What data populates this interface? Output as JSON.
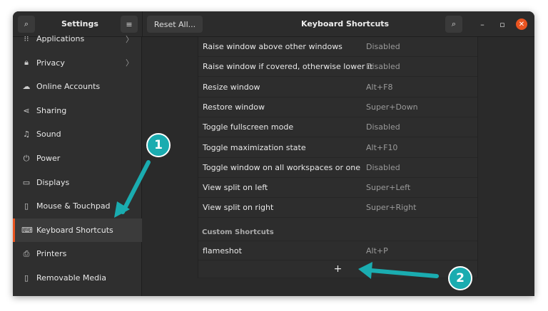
{
  "header": {
    "sidebar_title": "Settings",
    "reset_label": "Reset All...",
    "title": "Keyboard Shortcuts"
  },
  "sidebar": {
    "items": [
      {
        "label": "Applications",
        "icon": "grid-icon",
        "glyph": "⁝⁝",
        "chevron": true
      },
      {
        "label": "Privacy",
        "icon": "lock-icon",
        "glyph": "🔒︎",
        "chevron": true
      },
      {
        "label": "Online Accounts",
        "icon": "cloud-icon",
        "glyph": "☁"
      },
      {
        "label": "Sharing",
        "icon": "share-icon",
        "glyph": "⋖"
      },
      {
        "label": "Sound",
        "icon": "music-note-icon",
        "glyph": "♫"
      },
      {
        "label": "Power",
        "icon": "power-icon",
        "glyph": "⏻"
      },
      {
        "label": "Displays",
        "icon": "display-icon",
        "glyph": "▭"
      },
      {
        "label": "Mouse & Touchpad",
        "icon": "mouse-icon",
        "glyph": "▯"
      },
      {
        "label": "Keyboard Shortcuts",
        "icon": "keyboard-icon",
        "glyph": "⌨",
        "selected": true
      },
      {
        "label": "Printers",
        "icon": "printer-icon",
        "glyph": "⎙"
      },
      {
        "label": "Removable Media",
        "icon": "usb-icon",
        "glyph": "▯"
      }
    ]
  },
  "shortcuts": [
    {
      "name": "Raise window above other windows",
      "key": "Disabled"
    },
    {
      "name": "Raise window if covered, otherwise lower it",
      "key": "Disabled"
    },
    {
      "name": "Resize window",
      "key": "Alt+F8"
    },
    {
      "name": "Restore window",
      "key": "Super+Down"
    },
    {
      "name": "Toggle fullscreen mode",
      "key": "Disabled"
    },
    {
      "name": "Toggle maximization state",
      "key": "Alt+F10"
    },
    {
      "name": "Toggle window on all workspaces or one",
      "key": "Disabled"
    },
    {
      "name": "View split on left",
      "key": "Super+Left"
    },
    {
      "name": "View split on right",
      "key": "Super+Right"
    }
  ],
  "custom": {
    "heading": "Custom Shortcuts",
    "items": [
      {
        "name": "flameshot",
        "key": "Alt+P"
      }
    ],
    "add": "+"
  },
  "annotations": [
    "1",
    "2"
  ],
  "colors": {
    "accent": "#e95420",
    "annotation": "#1aacb0"
  }
}
